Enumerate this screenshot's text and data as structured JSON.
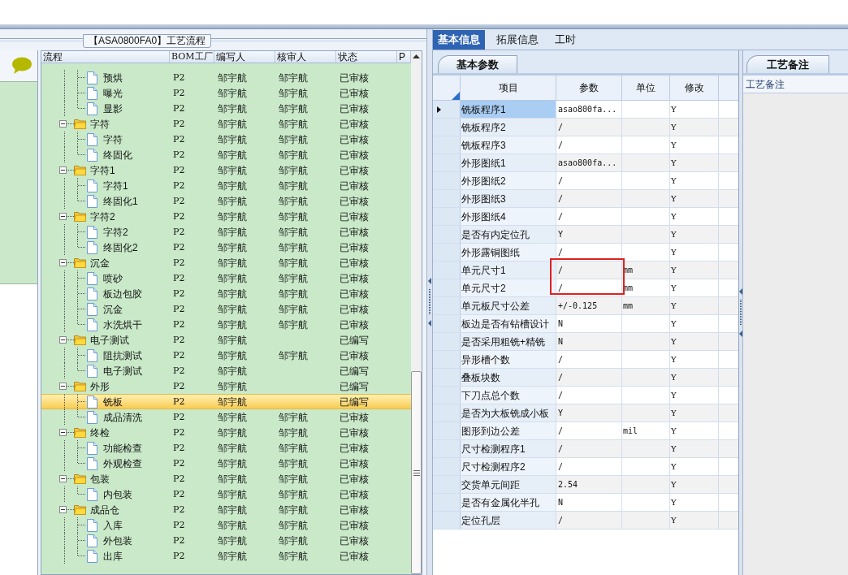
{
  "tree_panel": {
    "title": "【ASA0800FA0】工艺流程",
    "columns": [
      "流程",
      "BOM工厂",
      "编写人",
      "核审人",
      "状态",
      "P"
    ],
    "rows": [
      {
        "kind": "continued",
        "children": [
          {
            "kind": "file",
            "name": "预烘",
            "factory": "P2",
            "writer": "邹宇航",
            "reviewer": "邹宇航",
            "status": "已审核",
            "selected": false
          },
          {
            "kind": "file",
            "name": "曝光",
            "factory": "P2",
            "writer": "邹宇航",
            "reviewer": "邹宇航",
            "status": "已审核",
            "selected": false
          },
          {
            "kind": "file",
            "name": "显影",
            "factory": "P2",
            "writer": "邹宇航",
            "reviewer": "邹宇航",
            "status": "已审核",
            "selected": false
          }
        ]
      },
      {
        "kind": "folder",
        "expanded": true,
        "name": "字符",
        "factory": "P2",
        "writer": "邹宇航",
        "reviewer": "邹宇航",
        "status": "已审核",
        "selected": false,
        "children": [
          {
            "kind": "file",
            "name": "字符",
            "factory": "P2",
            "writer": "邹宇航",
            "reviewer": "邹宇航",
            "status": "已审核",
            "selected": false
          },
          {
            "kind": "file",
            "name": "终固化",
            "factory": "P2",
            "writer": "邹宇航",
            "reviewer": "邹宇航",
            "status": "已审核",
            "selected": false
          }
        ]
      },
      {
        "kind": "folder",
        "expanded": true,
        "name": "字符1",
        "factory": "P2",
        "writer": "邹宇航",
        "reviewer": "邹宇航",
        "status": "已审核",
        "selected": false,
        "children": [
          {
            "kind": "file",
            "name": "字符1",
            "factory": "P2",
            "writer": "邹宇航",
            "reviewer": "邹宇航",
            "status": "已审核",
            "selected": false
          },
          {
            "kind": "file",
            "name": "终固化1",
            "factory": "P2",
            "writer": "邹宇航",
            "reviewer": "邹宇航",
            "status": "已审核",
            "selected": false
          }
        ]
      },
      {
        "kind": "folder",
        "expanded": true,
        "name": "字符2",
        "factory": "P2",
        "writer": "邹宇航",
        "reviewer": "邹宇航",
        "status": "已审核",
        "selected": false,
        "children": [
          {
            "kind": "file",
            "name": "字符2",
            "factory": "P2",
            "writer": "邹宇航",
            "reviewer": "邹宇航",
            "status": "已审核",
            "selected": false
          },
          {
            "kind": "file",
            "name": "终固化2",
            "factory": "P2",
            "writer": "邹宇航",
            "reviewer": "邹宇航",
            "status": "已审核",
            "selected": false
          }
        ]
      },
      {
        "kind": "folder",
        "expanded": true,
        "name": "沉金",
        "factory": "P2",
        "writer": "邹宇航",
        "reviewer": "邹宇航",
        "status": "已审核",
        "selected": false,
        "children": [
          {
            "kind": "file",
            "name": "喷砂",
            "factory": "P2",
            "writer": "邹宇航",
            "reviewer": "邹宇航",
            "status": "已审核",
            "selected": false
          },
          {
            "kind": "file",
            "name": "板边包胶",
            "factory": "P2",
            "writer": "邹宇航",
            "reviewer": "邹宇航",
            "status": "已审核",
            "selected": false
          },
          {
            "kind": "file",
            "name": "沉金",
            "factory": "P2",
            "writer": "邹宇航",
            "reviewer": "邹宇航",
            "status": "已审核",
            "selected": false
          },
          {
            "kind": "file",
            "name": "水洗烘干",
            "factory": "P2",
            "writer": "邹宇航",
            "reviewer": "邹宇航",
            "status": "已审核",
            "selected": false
          }
        ]
      },
      {
        "kind": "folder",
        "expanded": true,
        "name": "电子测试",
        "factory": "P2",
        "writer": "邹宇航",
        "status": "已编写",
        "selected": false,
        "children": [
          {
            "kind": "file",
            "name": "阻抗测试",
            "factory": "P2",
            "writer": "邹宇航",
            "reviewer": "邹宇航",
            "status": "已审核",
            "selected": false
          },
          {
            "kind": "file",
            "name": "电子测试",
            "factory": "P2",
            "writer": "邹宇航",
            "status": "已编写",
            "selected": false
          }
        ]
      },
      {
        "kind": "folder",
        "expanded": true,
        "name": "外形",
        "factory": "P2",
        "writer": "邹宇航",
        "status": "已编写",
        "selected": false,
        "children": [
          {
            "kind": "file",
            "name": "铣板",
            "factory": "P2",
            "writer": "邹宇航",
            "status": "已编写",
            "selected": true
          },
          {
            "kind": "file",
            "name": "成品清洗",
            "factory": "P2",
            "writer": "邹宇航",
            "reviewer": "邹宇航",
            "status": "已审核",
            "selected": false
          }
        ]
      },
      {
        "kind": "folder",
        "expanded": true,
        "name": "终检",
        "factory": "P2",
        "writer": "邹宇航",
        "reviewer": "邹宇航",
        "status": "已审核",
        "selected": false,
        "children": [
          {
            "kind": "file",
            "name": "功能检查",
            "factory": "P2",
            "writer": "邹宇航",
            "reviewer": "邹宇航",
            "status": "已审核",
            "selected": false
          },
          {
            "kind": "file",
            "name": "外观检查",
            "factory": "P2",
            "writer": "邹宇航",
            "reviewer": "邹宇航",
            "status": "已审核",
            "selected": false
          }
        ]
      },
      {
        "kind": "folder",
        "expanded": true,
        "name": "包装",
        "factory": "P2",
        "writer": "邹宇航",
        "reviewer": "邹宇航",
        "status": "已审核",
        "selected": false,
        "children": [
          {
            "kind": "file",
            "name": "内包装",
            "factory": "P2",
            "writer": "邹宇航",
            "reviewer": "邹宇航",
            "status": "已审核",
            "selected": false
          }
        ]
      },
      {
        "kind": "folder",
        "expanded": true,
        "name": "成品仓",
        "factory": "P2",
        "writer": "邹宇航",
        "reviewer": "邹宇航",
        "status": "已审核",
        "selected": false,
        "children": [
          {
            "kind": "file",
            "name": "入库",
            "factory": "P2",
            "writer": "邹宇航",
            "reviewer": "邹宇航",
            "status": "已审核",
            "selected": false
          },
          {
            "kind": "file",
            "name": "外包装",
            "factory": "P2",
            "writer": "邹宇航",
            "reviewer": "邹宇航",
            "status": "已审核",
            "selected": false
          },
          {
            "kind": "file",
            "name": "出库",
            "factory": "P2",
            "writer": "邹宇航",
            "reviewer": "邹宇航",
            "status": "已审核",
            "selected": false
          }
        ]
      }
    ]
  },
  "detail_tabs": [
    {
      "label": "基本信息",
      "selected": true
    },
    {
      "label": "拓展信息",
      "selected": false
    },
    {
      "label": "工时",
      "selected": false
    }
  ],
  "param_tab": "基本参数",
  "params": {
    "columns": [
      "项目",
      "参数",
      "单位",
      "修改"
    ],
    "rows": [
      {
        "item": "铣板程序1",
        "value": "asao800fa...",
        "modify": "Y",
        "selected": true
      },
      {
        "item": "铣板程序2",
        "value": "/",
        "modify": "Y",
        "selected": false
      },
      {
        "item": "铣板程序3",
        "value": "/",
        "modify": "Y",
        "selected": false
      },
      {
        "item": "外形图纸1",
        "value": "asao800fa...",
        "modify": "Y",
        "selected": false
      },
      {
        "item": "外形图纸2",
        "value": "/",
        "modify": "Y",
        "selected": false
      },
      {
        "item": "外形图纸3",
        "value": "/",
        "modify": "Y",
        "selected": false
      },
      {
        "item": "外形图纸4",
        "value": "/",
        "modify": "Y",
        "selected": false
      },
      {
        "item": "是否有内定位孔",
        "value": "Y",
        "modify": "Y",
        "selected": false
      },
      {
        "item": "外形露铜图纸",
        "value": "/",
        "modify": "Y",
        "selected": false
      },
      {
        "item": "单元尺寸1",
        "value": "/",
        "unit": "mm",
        "modify": "Y",
        "selected": false
      },
      {
        "item": "单元尺寸2",
        "value": "/",
        "unit": "mm",
        "modify": "Y",
        "selected": false
      },
      {
        "item": "单元板尺寸公差",
        "value": "+/-0.125",
        "unit": "mm",
        "modify": "Y",
        "selected": false
      },
      {
        "item": "板边是否有钻槽设计",
        "value": "N",
        "modify": "Y",
        "selected": false
      },
      {
        "item": "是否采用粗铣+精铣",
        "value": "N",
        "modify": "Y",
        "selected": false
      },
      {
        "item": "异形槽个数",
        "value": "/",
        "modify": "Y",
        "selected": false
      },
      {
        "item": "叠板块数",
        "value": "/",
        "modify": "Y",
        "selected": false
      },
      {
        "item": "下刀点总个数",
        "value": "/",
        "modify": "Y",
        "selected": false
      },
      {
        "item": "是否为大板铣成小板",
        "value": "Y",
        "modify": "Y",
        "selected": false
      },
      {
        "item": "图形到边公差",
        "value": "/",
        "unit": "mil",
        "modify": "Y",
        "selected": false
      },
      {
        "item": "尺寸检测程序1",
        "value": "/",
        "modify": "Y",
        "selected": false
      },
      {
        "item": "尺寸检测程序2",
        "value": "/",
        "modify": "Y",
        "selected": false
      },
      {
        "item": "交货单元间距",
        "value": "2.54",
        "modify": "Y",
        "selected": false
      },
      {
        "item": "是否有金属化半孔",
        "value": "N",
        "modify": "Y",
        "selected": false
      },
      {
        "item": "定位孔层",
        "value": "/",
        "modify": "Y",
        "selected": false
      }
    ]
  },
  "notes": {
    "tab": "工艺备注",
    "column": "工艺备注"
  }
}
